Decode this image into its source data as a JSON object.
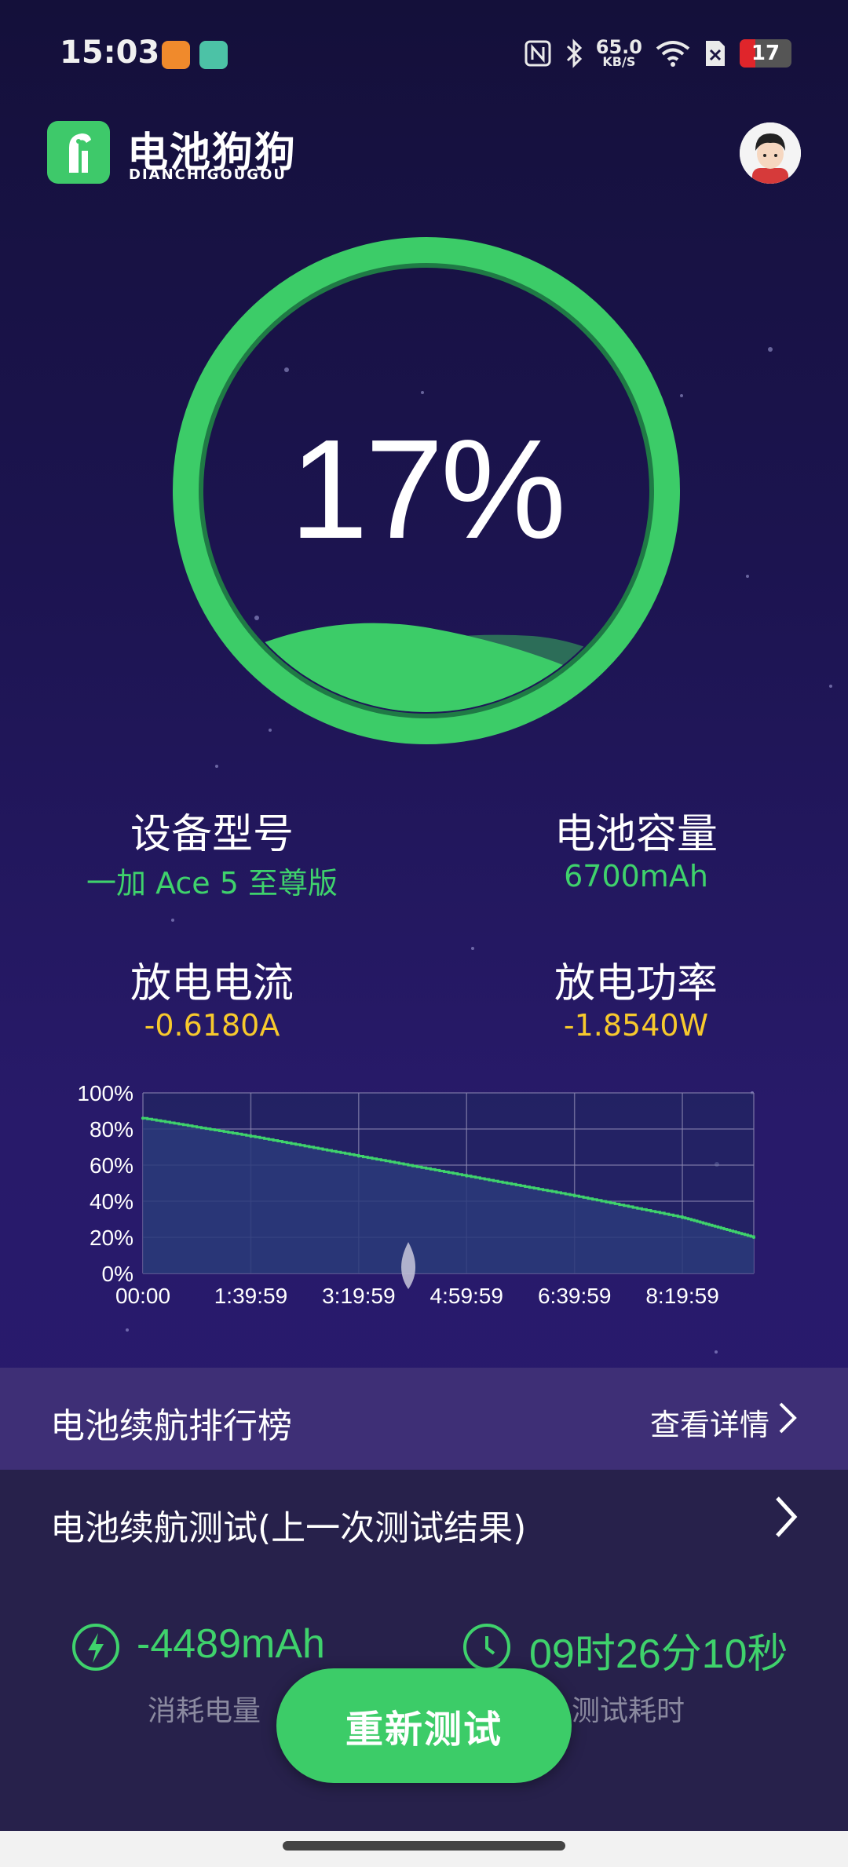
{
  "status_bar": {
    "time": "15:03",
    "net_speed_value": "65.0",
    "net_speed_unit": "KB/S",
    "battery_level": "17",
    "icons": [
      "nfc-icon",
      "bluetooth-icon",
      "wifi-icon",
      "sim-off-icon"
    ]
  },
  "header": {
    "app_name": "电池狗狗",
    "app_name_en": "DIANCHIGOUGOU"
  },
  "gauge": {
    "percent": "17%",
    "level": 0.17,
    "ring_color": "#3ccc68"
  },
  "info": {
    "device_model_label": "设备型号",
    "device_model_value": "一加 Ace 5 至尊版",
    "capacity_label": "电池容量",
    "capacity_value": "6700mAh",
    "current_label": "放电电流",
    "current_value": "-0.6180A",
    "power_label": "放电功率",
    "power_value": "-1.8540W"
  },
  "chart_data": {
    "type": "line",
    "x_labels": [
      "00:00",
      "1:39:59",
      "3:19:59",
      "4:59:59",
      "6:39:59",
      "8:19:59"
    ],
    "y_labels": [
      "100%",
      "80%",
      "60%",
      "40%",
      "20%",
      "0%"
    ],
    "ylim": [
      0,
      100
    ],
    "x_hours": [
      0,
      1.667,
      3.333,
      5.0,
      6.667,
      8.333,
      9.436
    ],
    "values": [
      86,
      76,
      65,
      54,
      43,
      31,
      20
    ],
    "grid": true,
    "line_color": "#3fd26c"
  },
  "ranking": {
    "title": "电池续航排行榜",
    "details_label": "查看详情"
  },
  "test": {
    "title": "电池续航测试(上一次测试结果)",
    "consumed_value": "-4489mAh",
    "consumed_label": "消耗电量",
    "duration_value": "09时26分10秒",
    "duration_label": "测试耗时",
    "retest_label": "重新测试"
  }
}
